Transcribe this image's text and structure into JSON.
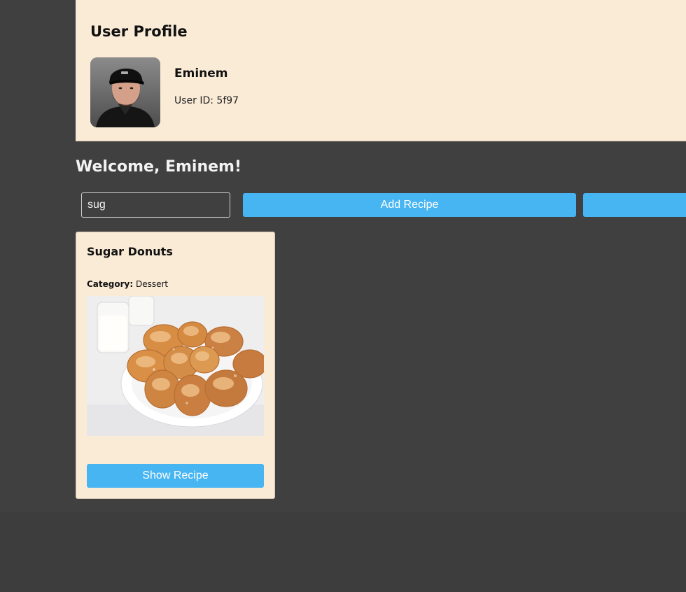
{
  "profile": {
    "title": "User Profile",
    "name": "Eminem",
    "user_id_label": "User ID: 5f97"
  },
  "welcome": "Welcome, Eminem!",
  "search": {
    "value": "sug",
    "placeholder": ""
  },
  "toolbar": {
    "add_recipe_label": "Add Recipe",
    "extra_button_label": ""
  },
  "recipes": [
    {
      "title": "Sugar Donuts",
      "category_label": "Category:",
      "category_value": "Dessert",
      "image_alt": "Sugar donuts on a plate",
      "show_label": "Show Recipe"
    }
  ],
  "colors": {
    "background": "#414040",
    "panel": "#faebd7",
    "accent": "#47b5f2"
  }
}
